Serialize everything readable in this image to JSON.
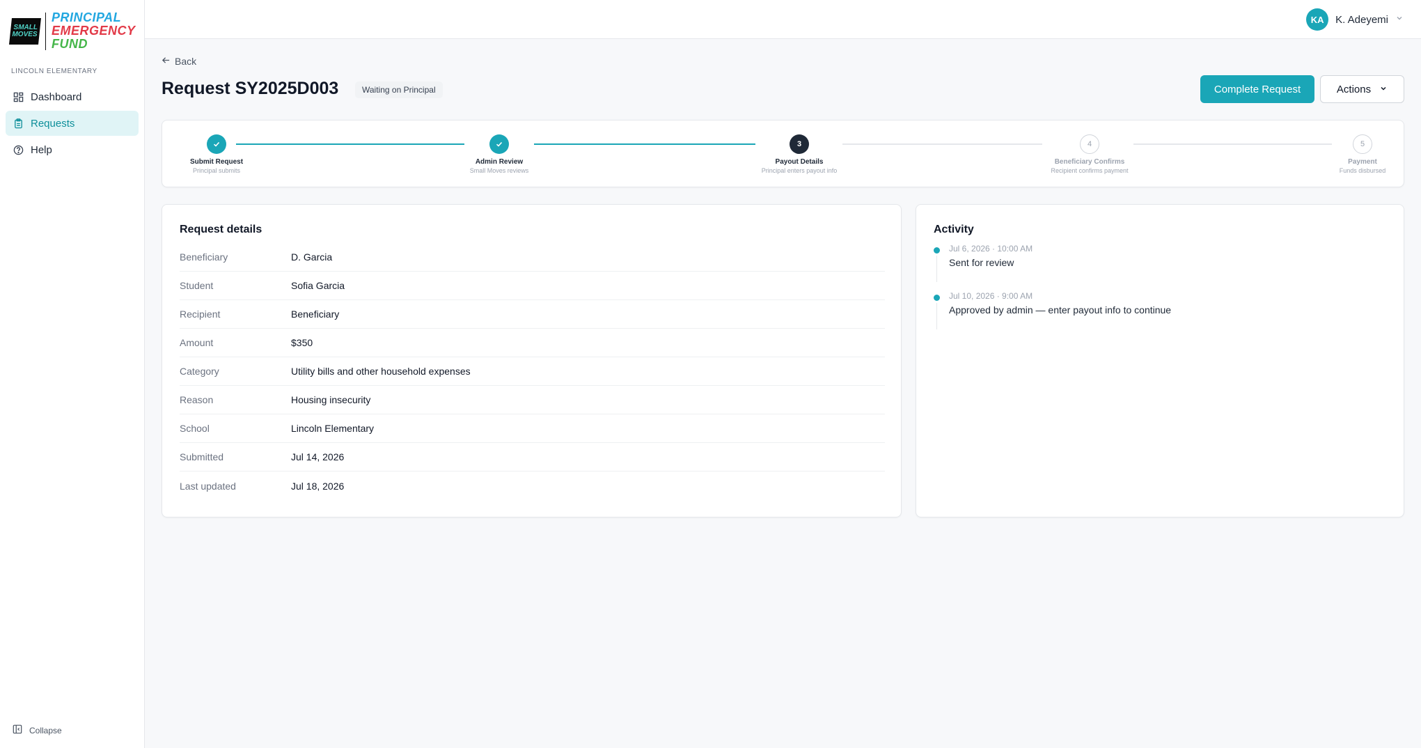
{
  "brand": {
    "badge_line1": "SMALL",
    "badge_line2": "MOVES",
    "name_line1": "PRINCIPAL",
    "name_line2": "EMERGENCY",
    "name_line3": "FUND"
  },
  "sidebar": {
    "school": "LINCOLN ELEMENTARY",
    "items": [
      {
        "label": "Dashboard",
        "icon": "dashboard-icon"
      },
      {
        "label": "Requests",
        "icon": "clipboard-icon",
        "active": true
      },
      {
        "label": "Help",
        "icon": "help-circle-icon"
      }
    ],
    "collapse_label": "Collapse"
  },
  "topbar": {
    "user_initials": "KA",
    "user_name": "K. Adeyemi"
  },
  "page": {
    "back_label": "Back",
    "title": "Request SY2025D003",
    "status": "Waiting on Principal",
    "primary_action": "Complete Request",
    "secondary_action": "Actions"
  },
  "stepper": {
    "steps": [
      {
        "num": "1",
        "label": "Submit Request",
        "sub": "Principal submits",
        "state": "done"
      },
      {
        "num": "2",
        "label": "Admin Review",
        "sub": "Small Moves reviews",
        "state": "done"
      },
      {
        "num": "3",
        "label": "Payout Details",
        "sub": "Principal enters payout info",
        "state": "current"
      },
      {
        "num": "4",
        "label": "Beneficiary Confirms",
        "sub": "Recipient confirms payment",
        "state": "todo"
      },
      {
        "num": "5",
        "label": "Payment",
        "sub": "Funds disbursed",
        "state": "todo"
      }
    ]
  },
  "details": {
    "title": "Request details",
    "rows": [
      {
        "k": "Beneficiary",
        "v": "D. Garcia"
      },
      {
        "k": "Student",
        "v": "Sofia Garcia"
      },
      {
        "k": "Recipient",
        "v": "Beneficiary"
      },
      {
        "k": "Amount",
        "v": "$350"
      },
      {
        "k": "Category",
        "v": "Utility bills and other household expenses"
      },
      {
        "k": "Reason",
        "v": "Housing insecurity"
      },
      {
        "k": "School",
        "v": "Lincoln Elementary"
      },
      {
        "k": "Submitted",
        "v": "Jul 14, 2026"
      },
      {
        "k": "Last updated",
        "v": "Jul 18, 2026"
      }
    ]
  },
  "activity": {
    "title": "Activity",
    "events": [
      {
        "time": "Jul 6, 2026 · 10:00 AM",
        "msg": "Sent for review"
      },
      {
        "time": "Jul 10, 2026 · 9:00 AM",
        "msg": "Approved by admin — enter payout info to continue"
      }
    ]
  },
  "colors": {
    "accent": "#1aa6b7",
    "current_step": "#1f2937"
  }
}
